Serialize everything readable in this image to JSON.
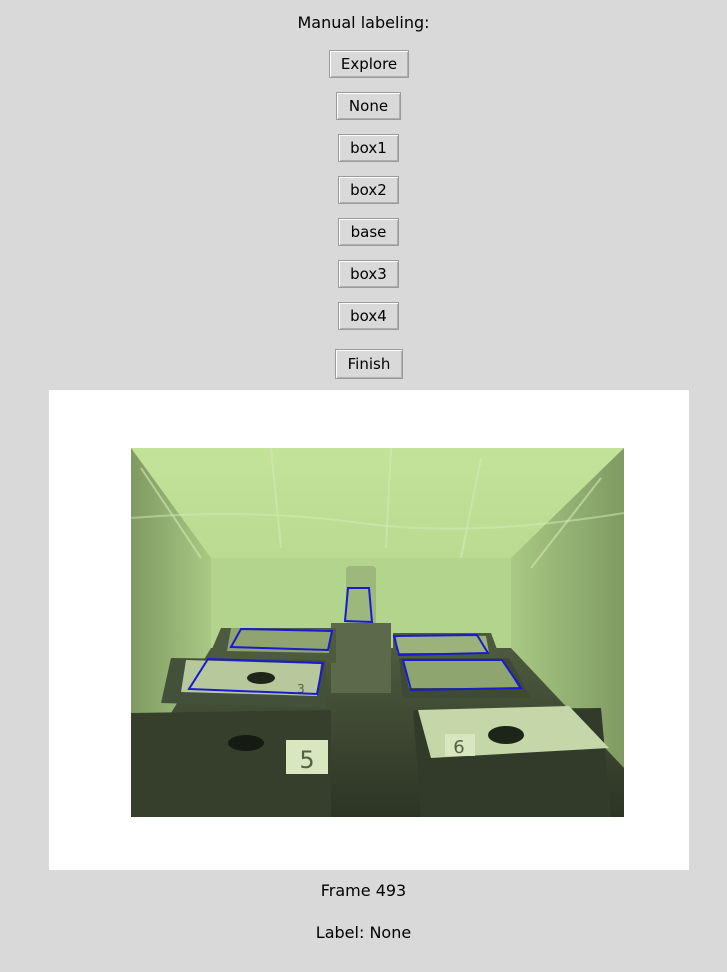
{
  "header": {
    "title": "Manual labeling:"
  },
  "buttons": {
    "explore": "Explore",
    "none": "None",
    "box1": "box1",
    "box2": "box2",
    "base": "base",
    "box3": "box3",
    "box4": "box4",
    "finish": "Finish"
  },
  "frame": {
    "info": "Frame 493",
    "label_info": "Label: None",
    "box_color": "#1a1ad0",
    "scene_tint": "#b8d98f",
    "scene_labels": [
      "3",
      "5",
      "6"
    ]
  }
}
